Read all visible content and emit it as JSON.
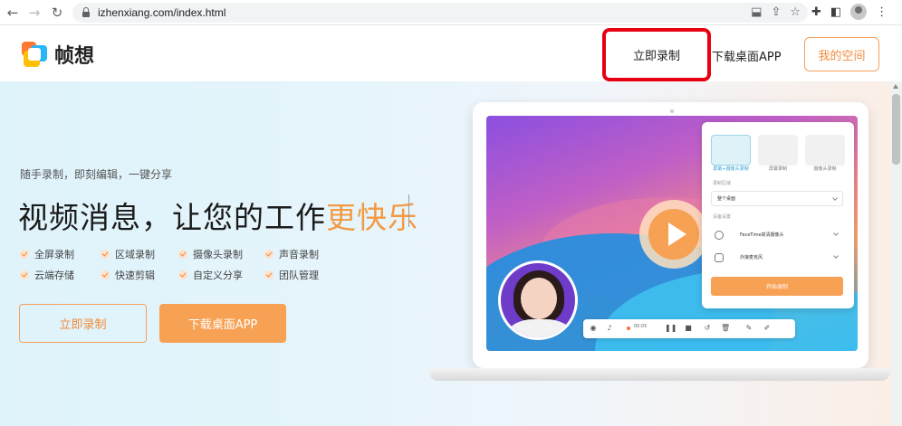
{
  "browser": {
    "url": "izhenxiang.com/index.html"
  },
  "header": {
    "logo_text": "帧想",
    "nav_record": "立即录制",
    "nav_download": "下载桌面APP",
    "nav_space": "我的空间"
  },
  "hero": {
    "tagline": "随手录制，即刻编辑，一键分享",
    "headline_main": "视频消息，让您的工作",
    "headline_highlight": "更快乐",
    "features": [
      "全屏录制",
      "区域录制",
      "摄像头录制",
      "声音录制",
      "云端存储",
      "快速剪辑",
      "自定义分享",
      "团队管理"
    ],
    "btn_record": "立即录制",
    "btn_download": "下载桌面APP"
  },
  "mockup": {
    "modes": [
      "屏幕+摄像头录制",
      "屏幕录制",
      "摄像头录制"
    ],
    "section_record_area": "录制区域",
    "record_area_value": "整个桌面",
    "section_device": "设备设置",
    "camera_value": "FaceTime高清摄像头",
    "mic_value": "外接麦克风",
    "start_button": "开始录制",
    "timer": "00:05"
  },
  "colors": {
    "accent": "#f7a154",
    "highlight_box": "#e60012"
  }
}
